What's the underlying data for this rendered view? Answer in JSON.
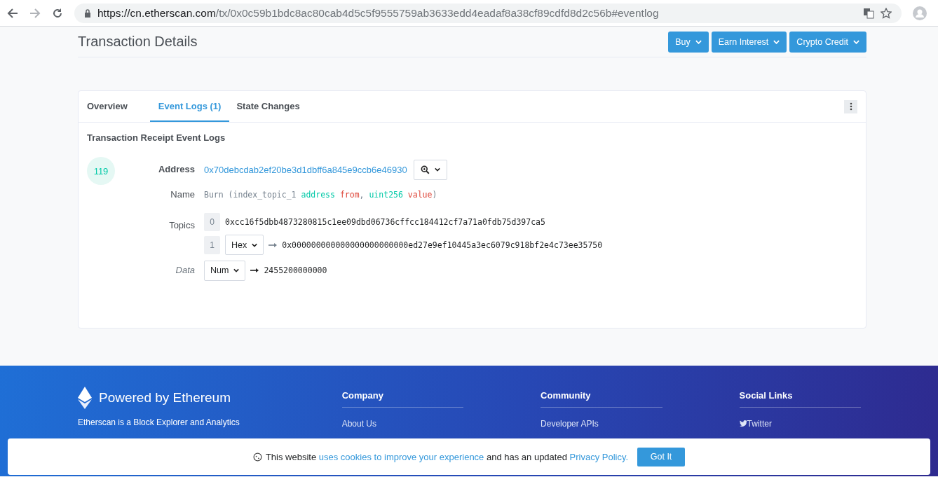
{
  "browser": {
    "url_host": "https://cn.etherscan.com",
    "url_path": "/tx/0x0c59b1bdc8ac80cab4d5c5f9555759ab3633edd4eadaf8a38cf89cdfd8d2c56b#eventlog"
  },
  "page": {
    "title": "Transaction Details",
    "buttons": [
      "Buy",
      "Earn Interest",
      "Crypto Credit"
    ]
  },
  "tabs": [
    {
      "label": "Overview",
      "selected": false
    },
    {
      "label": "Event Logs (1)",
      "selected": true
    },
    {
      "label": "State Changes",
      "selected": false
    }
  ],
  "log": {
    "heading": "Transaction Receipt Event Logs",
    "index": "119",
    "address_label": "Address",
    "address": "0x70debcdab2ef20be3d1dbff6a845e9ccb6e46930",
    "name_label": "Name",
    "name_parts": [
      {
        "kind": "plain",
        "text": "Burn (index_topic_1 "
      },
      {
        "kind": "type",
        "text": "address"
      },
      {
        "kind": "param",
        "text": " from"
      },
      {
        "kind": "plain",
        "text": ", "
      },
      {
        "kind": "type",
        "text": "uint256"
      },
      {
        "kind": "param",
        "text": " value"
      },
      {
        "kind": "plain",
        "text": ")"
      }
    ],
    "topics_label": "Topics",
    "topics": [
      {
        "index": "0",
        "value": "0xcc16f5dbb4873280815c1ee09dbd06736cffcc184412cf7a71a0fdb75d397ca5"
      },
      {
        "index": "1",
        "format": "Hex",
        "value": "0x000000000000000000000000ed27e9ef10445a3ec6079c918bf2e4c73ee35750"
      }
    ],
    "data_label": "Data",
    "data_format": "Num",
    "data_value": "2455200000000"
  },
  "footer": {
    "brand": "Powered by Ethereum",
    "tagline": "Etherscan is a Block Explorer and Analytics",
    "columns": [
      {
        "title": "Company",
        "link": "About Us",
        "kind": "plain"
      },
      {
        "title": "Community",
        "link": "Developer APIs",
        "kind": "plain"
      },
      {
        "title": "Social Links",
        "link": "Twitter",
        "kind": "twitter"
      }
    ]
  },
  "cookie": {
    "text_before": "This website ",
    "link1": "uses cookies to improve your experience",
    "text_middle": " and has an updated ",
    "link2": "Privacy Policy.",
    "button": "Got It"
  }
}
